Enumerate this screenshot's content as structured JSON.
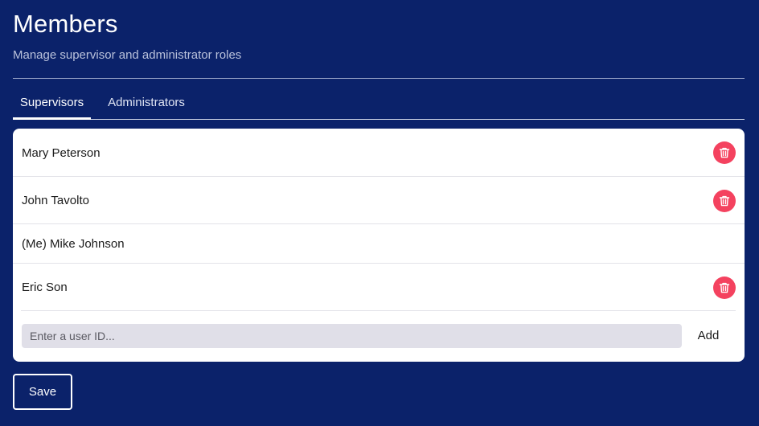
{
  "header": {
    "title": "Members",
    "subtitle": "Manage supervisor and administrator roles"
  },
  "tabs": [
    {
      "label": "Supervisors",
      "active": true
    },
    {
      "label": "Administrators",
      "active": false
    }
  ],
  "members": [
    {
      "name": "Mary Peterson",
      "deletable": true
    },
    {
      "name": "John Tavolto",
      "deletable": true
    },
    {
      "name": "(Me) Mike Johnson",
      "deletable": false
    },
    {
      "name": "Eric Son",
      "deletable": true
    }
  ],
  "add_member": {
    "placeholder": "Enter a user ID...",
    "value": "",
    "button_label": "Add"
  },
  "save_label": "Save",
  "icons": {
    "delete": "trash-icon"
  },
  "colors": {
    "background": "#0b226a",
    "delete_accent": "#f4425f",
    "card": "#ffffff"
  }
}
